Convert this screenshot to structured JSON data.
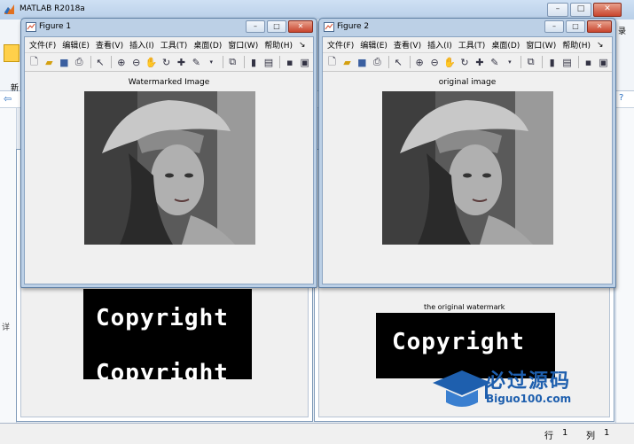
{
  "main": {
    "title": "MATLAB R2018a",
    "ribbon_label_new": "新",
    "ribbon_label_right": "录",
    "left_panel_label": "详",
    "status": {
      "row_label": "行",
      "row_value": "1",
      "col_label": "列",
      "col_value": "1"
    }
  },
  "menu": {
    "file": "文件(F)",
    "edit": "编辑(E)",
    "view": "查看(V)",
    "insert": "插入(I)",
    "tools": "工具(T)",
    "desktop": "桌面(D)",
    "window": "窗口(W)",
    "help": "帮助(H)",
    "more": "↘"
  },
  "figure1": {
    "title": "Figure 1",
    "axes_title": "Watermarked Image"
  },
  "figure2": {
    "title": "Figure 2",
    "axes_title": "original  image"
  },
  "watermark_left": {
    "text": "Copyright",
    "text2": "Copyright"
  },
  "watermark_right": {
    "caption": "the original watermark",
    "text": "Copyright"
  },
  "brand": {
    "name": "必过源码",
    "url": "Biguo100.com"
  },
  "colors": {
    "titlebar": "#bcd0e6",
    "accent": "#1e5fae"
  }
}
